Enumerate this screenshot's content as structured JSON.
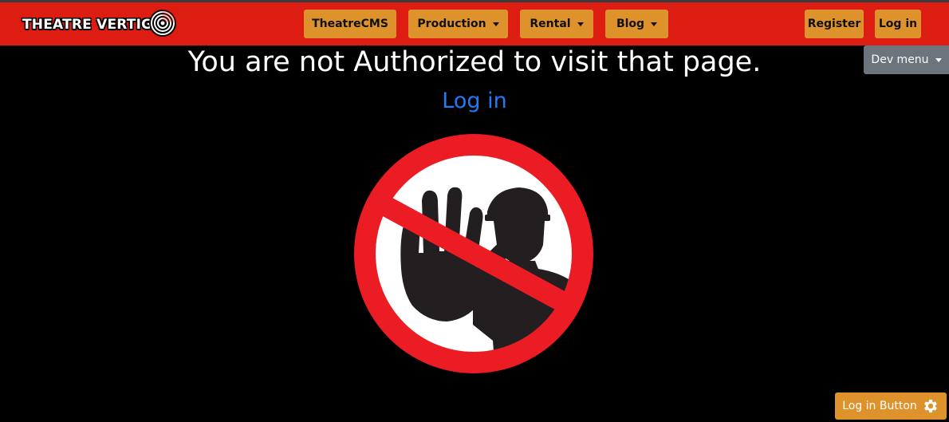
{
  "brand": {
    "name": "THEATRE VERTIGO",
    "logo_icon": "spiral-logo-icon"
  },
  "nav": {
    "items": [
      {
        "label": "TheatreCMS",
        "has_dropdown": false
      },
      {
        "label": "Production",
        "has_dropdown": true
      },
      {
        "label": "Rental",
        "has_dropdown": true
      },
      {
        "label": "Blog",
        "has_dropdown": true
      }
    ],
    "register_label": "Register",
    "login_label": "Log in"
  },
  "dev_menu": {
    "label": "Dev menu"
  },
  "main": {
    "headline": "You are not Authorized to visit that page.",
    "login_link": "Log in",
    "image_icon": "no-entry-stop-hand-icon"
  },
  "floating_button": {
    "label": "Log in Button",
    "icon": "gear-icon"
  },
  "colors": {
    "navbar": "#dd1c12",
    "button": "#dd922c",
    "link": "#1e7cf5",
    "dev_menu": "#6c757d",
    "background": "#000000"
  }
}
